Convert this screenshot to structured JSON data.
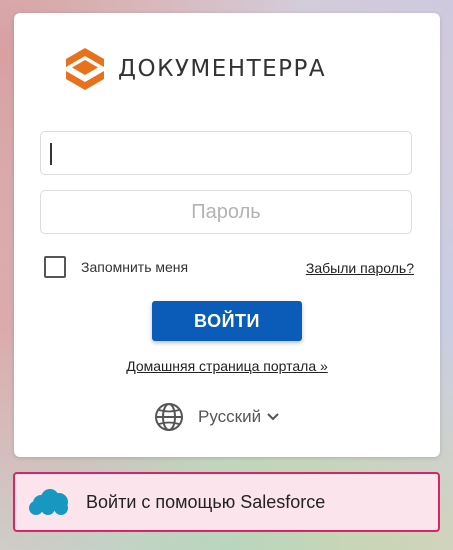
{
  "brand": {
    "name": "ДОКУМЕНТЕРРА",
    "logo_icon": "documenterra-chevrons-logo",
    "accent_color": "#e8711c"
  },
  "login_form": {
    "username_value": "",
    "password_placeholder": "Пароль",
    "remember_label": "Запомнить меня",
    "remember_checked": false,
    "forgot_label": "Забыли пароль?",
    "submit_label": "ВОЙТИ",
    "submit_color": "#0b5cb8"
  },
  "portal_link": "Домашняя страница портала »",
  "language": {
    "icon": "globe-icon",
    "selected": "Русский"
  },
  "sso": {
    "icon": "salesforce-cloud-icon",
    "label": "Войти с помощью Salesforce",
    "border_color": "#d6256a",
    "background": "#fce4ec"
  }
}
